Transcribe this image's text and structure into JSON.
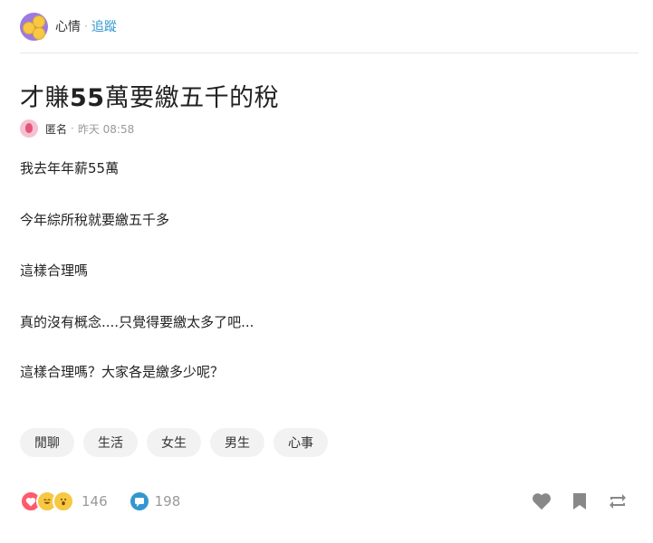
{
  "forum": {
    "name": "心情",
    "follow_label": "追蹤"
  },
  "post": {
    "title_prefix": "才賺",
    "title_number": "55",
    "title_suffix": "萬要繳五千的稅",
    "author": "匿名",
    "time": "昨天 08:58",
    "paragraphs": [
      "我去年年薪55萬",
      "今年綜所稅就要繳五千多",
      "這樣合理嗎",
      "真的沒有概念....只覺得要繳太多了吧...",
      "這樣合理嗎？大家各是繳多少呢？"
    ],
    "tags": [
      "閒聊",
      "生活",
      "女生",
      "男生",
      "心事"
    ]
  },
  "stats": {
    "reaction_count": "146",
    "comment_count": "198",
    "reaction_icons": [
      "heart-icon",
      "laugh-icon",
      "wow-icon"
    ]
  },
  "colors": {
    "accent": "#3397cf",
    "comment_blue": "#3397cf",
    "icon_gray": "#888888"
  }
}
